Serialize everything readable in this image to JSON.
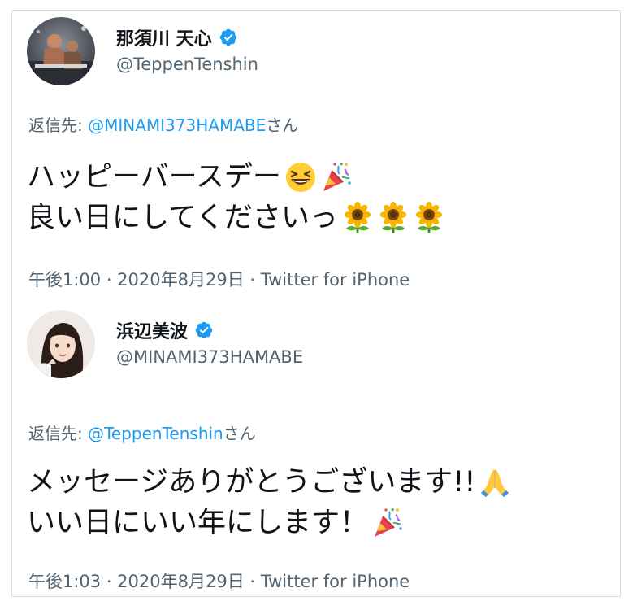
{
  "colors": {
    "link": "#1d9bf0",
    "secondary_text": "#536471",
    "primary_text": "#0f1419",
    "verified": "#1d9bf0"
  },
  "tweets": [
    {
      "display_name": "那須川 天心",
      "handle": "@TeppenTenshin",
      "reply_prefix": "返信先: ",
      "reply_to": "@MINAMI373HAMABE",
      "reply_suffix": "さん",
      "text_lines": [
        "ハッピーバースデー",
        "良い日にしてくださいっ"
      ],
      "emojis": [
        "grinning-squinting-face",
        "party-popper",
        "sunflower",
        "sunflower",
        "sunflower"
      ],
      "meta": "午後1:00 · 2020年8月29日 · Twitter for iPhone"
    },
    {
      "display_name": "浜辺美波",
      "handle": "@MINAMI373HAMABE",
      "reply_prefix": "返信先: ",
      "reply_to": "@TeppenTenshin",
      "reply_suffix": "さん",
      "text_lines": [
        "メッセージありがとうございます!!",
        "いい日にいい年にします！"
      ],
      "emojis": [
        "folded-hands",
        "party-popper"
      ],
      "meta": "午後1:03 · 2020年8月29日 · Twitter for iPhone"
    }
  ]
}
